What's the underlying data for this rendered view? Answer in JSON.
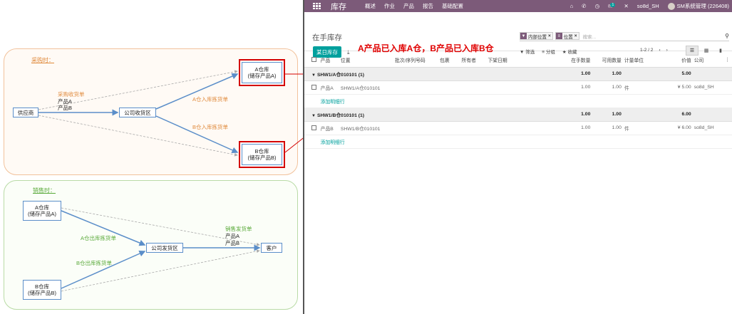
{
  "diagram": {
    "purchase_title": "采购时：",
    "sales_title": "销售时：",
    "nodes": {
      "supplier": "供应商",
      "receiving_area": "公司收货区",
      "warehouse_a_top": "A仓库\n(储存产品A)",
      "warehouse_b_top": "B仓库\n(储存产品B)",
      "warehouse_a_bottom": "A仓库\n(储存产品A)",
      "warehouse_b_bottom": "B仓库\n(储存产品B)",
      "shipping_area": "公司发货区",
      "customer": "客户"
    },
    "labels": {
      "purchase_receipt": "采购收货单",
      "product_a": "产品A",
      "product_b": "产品B",
      "a_in_picking": "A仓入库拣货单",
      "b_in_picking": "B仓入库拣货单",
      "a_out_picking": "A仓出库拣货单",
      "b_out_picking": "B仓出库拣货单",
      "sales_delivery": "销售发货单",
      "sales_product_a": "产品A",
      "sales_product_b": "产品B"
    },
    "colors": {
      "orange": "#e08a3c",
      "green": "#5aaa3a",
      "blue": "#5b8ec9",
      "red": "#d40000"
    }
  },
  "app": {
    "brand": "库存",
    "menu": [
      "概述",
      "作业",
      "产品",
      "报告",
      "基础配置"
    ],
    "chat_badge": "1",
    "company": "so8d_SH",
    "user": "SM系统管理 (226408)",
    "page_title": "在手库存",
    "primary_button": "某日库存",
    "annotation": "A产品已入库A仓，B产品已入库B仓",
    "facets": [
      {
        "icon": "filter-icon",
        "value": "内部位置"
      },
      {
        "icon": "group-icon",
        "value": "位置"
      }
    ],
    "search_placeholder": "搜索...",
    "filters_label": "筛选",
    "groupby_label": "分组",
    "favorites_label": "收藏",
    "pager": "1-2 / 2",
    "columns": {
      "product": "产品",
      "location": "位置",
      "lot": "批次/序列号码",
      "package": "包裹",
      "owner": "所有者",
      "date": "下架日期",
      "on_hand": "在手数量",
      "available": "可用数量",
      "uom": "计量单位",
      "value": "价值",
      "company": "公司"
    },
    "groups": [
      {
        "name": "SHW1/A仓010101 (1)",
        "on_hand": "1.00",
        "available": "1.00",
        "value": "5.00",
        "row": {
          "product": "产品A",
          "location": "SHW1/A仓010101",
          "on_hand": "1.00",
          "available": "1.00",
          "uom": "件",
          "value": "¥ 5.00",
          "company": "so8d_SH"
        },
        "add_line": "添加明细行"
      },
      {
        "name": "SHW1/B仓010101 (1)",
        "on_hand": "1.00",
        "available": "1.00",
        "value": "6.00",
        "row": {
          "product": "产品B",
          "location": "SHW1/B仓010101",
          "on_hand": "1.00",
          "available": "1.00",
          "uom": "件",
          "value": "¥ 6.00",
          "company": "so8d_SH"
        },
        "add_line": "添加明细行"
      }
    ]
  }
}
